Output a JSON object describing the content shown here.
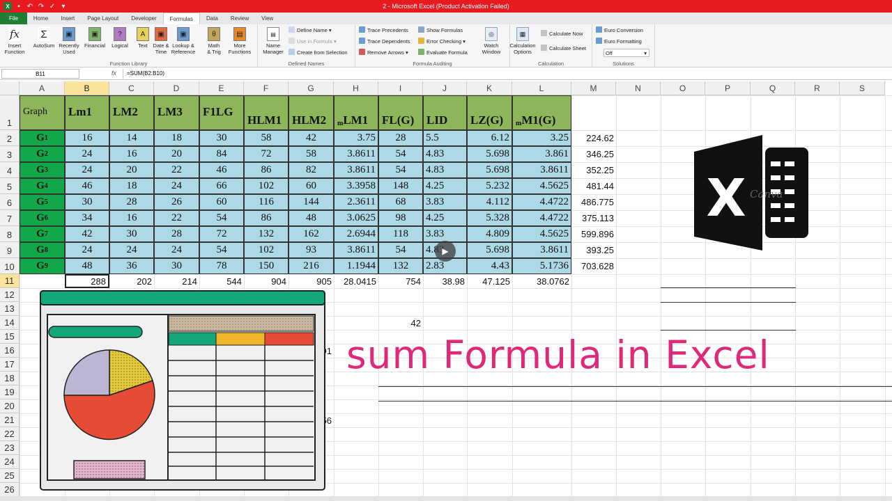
{
  "window": {
    "title": "2 - Microsoft Excel (Product Activation Failed)"
  },
  "tabs": [
    "File",
    "Home",
    "Insert",
    "Page Layout",
    "Developer",
    "Formulas",
    "Data",
    "Review",
    "View"
  ],
  "active_tab": "Formulas",
  "ribbon": {
    "function_library": {
      "label": "Function Library",
      "buttons": [
        {
          "label": "Insert\nFunction",
          "icon": "fx-icon",
          "glyph": "fx"
        },
        {
          "label": "AutoSum",
          "icon": "sigma-icon",
          "glyph": "Σ"
        },
        {
          "label": "Recently\nUsed",
          "icon": "recent-book-icon",
          "glyph": "▣"
        },
        {
          "label": "Financial",
          "icon": "financial-book-icon",
          "glyph": "▣"
        },
        {
          "label": "Logical",
          "icon": "logical-book-icon",
          "glyph": "?"
        },
        {
          "label": "Text",
          "icon": "text-book-icon",
          "glyph": "A"
        },
        {
          "label": "Date &\nTime",
          "icon": "date-book-icon",
          "glyph": "▣"
        },
        {
          "label": "Lookup &\nReference",
          "icon": "lookup-book-icon",
          "glyph": "▣"
        },
        {
          "label": "Math\n& Trig",
          "icon": "math-book-icon",
          "glyph": "θ"
        },
        {
          "label": "More\nFunctions",
          "icon": "more-book-icon",
          "glyph": "▤"
        }
      ]
    },
    "defined_names": {
      "label": "Defined Names",
      "name_manager": "Name\nManager",
      "define_name": "Define Name",
      "use_in_formula": "Use in Formula",
      "create_from_selection": "Create from Selection"
    },
    "formula_auditing": {
      "label": "Formula Auditing",
      "trace_precedents": "Trace Precedents",
      "trace_dependents": "Trace Dependents",
      "remove_arrows": "Remove Arrows",
      "show_formulas": "Show Formulas",
      "error_checking": "Error Checking",
      "evaluate_formula": "Evaluate Formula",
      "watch_window": "Watch\nWindow"
    },
    "calculation": {
      "label": "Calculation",
      "options": "Calculation\nOptions",
      "calc_now": "Calculate Now",
      "calc_sheet": "Calculate Sheet"
    },
    "solutions": {
      "label": "Solutions",
      "euro_conversion": "Euro Conversion",
      "euro_formatting": "Euro Formatting",
      "off": "Off"
    }
  },
  "formula_bar": {
    "name_box": "B11",
    "fx": "fx",
    "formula": "=SUM(B2:B10)"
  },
  "columns": [
    "A",
    "B",
    "C",
    "D",
    "E",
    "F",
    "G",
    "H",
    "I",
    "J",
    "K",
    "L",
    "M",
    "N",
    "O",
    "P",
    "Q",
    "R",
    "S"
  ],
  "selected_column": "B",
  "rows": [
    "1",
    "2",
    "3",
    "4",
    "5",
    "6",
    "7",
    "8",
    "9",
    "10",
    "11",
    "12",
    "13",
    "14",
    "15",
    "16",
    "17",
    "18",
    "19",
    "20",
    "21",
    "22",
    "23",
    "24",
    "25",
    "26"
  ],
  "selected_row": "11",
  "header_row": {
    "a": "Graph",
    "cols": [
      {
        "main": "Lm1"
      },
      {
        "main": "LM2"
      },
      {
        "main": "LM3"
      },
      {
        "main": "F1LG"
      },
      {
        "main": "HLM1"
      },
      {
        "main": "HLM2"
      },
      {
        "sup": "m",
        "main": "LM1"
      },
      {
        "main": "FL(G)"
      },
      {
        "main": "LID"
      },
      {
        "main": "LZ(G)"
      },
      {
        "sup": "m",
        "main": "M1(G)"
      }
    ]
  },
  "data_rows": [
    {
      "g": "G",
      "sub": "1",
      "vals": [
        "16",
        "14",
        "18",
        "30",
        "58",
        "42",
        "3.75",
        "28",
        "5.5",
        "6.12",
        "3.25"
      ],
      "m": "224.62"
    },
    {
      "g": "G",
      "sub": "2",
      "vals": [
        "24",
        "16",
        "20",
        "84",
        "72",
        "58",
        "3.8611",
        "54",
        "4.83",
        "5.698",
        "3.861"
      ],
      "m": "346.25"
    },
    {
      "g": "G",
      "sub": "3",
      "vals": [
        "24",
        "20",
        "22",
        "46",
        "86",
        "82",
        "3.8611",
        "54",
        "4.83",
        "5.698",
        "3.8611"
      ],
      "m": "352.25"
    },
    {
      "g": "G",
      "sub": "4",
      "vals": [
        "46",
        "18",
        "24",
        "66",
        "102",
        "60",
        "3.3958",
        "148",
        "4.25",
        "5.232",
        "4.5625"
      ],
      "m": "481.44"
    },
    {
      "g": "G",
      "sub": "5",
      "vals": [
        "30",
        "28",
        "26",
        "60",
        "116",
        "144",
        "2.3611",
        "68",
        "3.83",
        "4.112",
        "4.4722"
      ],
      "m": "486.775"
    },
    {
      "g": "G",
      "sub": "6",
      "vals": [
        "34",
        "16",
        "22",
        "54",
        "86",
        "48",
        "3.0625",
        "98",
        "4.25",
        "5.328",
        "4.4722"
      ],
      "m": "375.113"
    },
    {
      "g": "G",
      "sub": "7",
      "vals": [
        "42",
        "30",
        "28",
        "72",
        "132",
        "162",
        "2.6944",
        "118",
        "3.83",
        "4.809",
        "4.5625"
      ],
      "m": "599.896"
    },
    {
      "g": "G",
      "sub": "8",
      "vals": [
        "24",
        "24",
        "24",
        "54",
        "102",
        "93",
        "3.8611",
        "54",
        "4.83",
        "5.698",
        "3.8611"
      ],
      "m": "393.25"
    },
    {
      "g": "G",
      "sub": "9",
      "vals": [
        "48",
        "36",
        "30",
        "78",
        "150",
        "216",
        "1.1944",
        "132",
        "2.83",
        "4.43",
        "5.1736"
      ],
      "m": "703.628"
    }
  ],
  "sum_row": [
    "288",
    "202",
    "214",
    "544",
    "904",
    "905",
    "28.0415",
    "754",
    "38.98",
    "47.125",
    "38.0762"
  ],
  "stray": {
    "i14": "42",
    "g16": "91",
    "g21": "56"
  },
  "overlay_text": "sum Formula in Excel",
  "logo": {
    "icon": "excel-logo-icon",
    "watermark": "Canva"
  },
  "colors": {
    "title_bar": "#e8191f",
    "header_green": "#8db55a",
    "graph_green": "#12a84a",
    "data_blue": "#add8e6",
    "overlay_pink": "#e0287a",
    "selection": "#fbe39c"
  }
}
